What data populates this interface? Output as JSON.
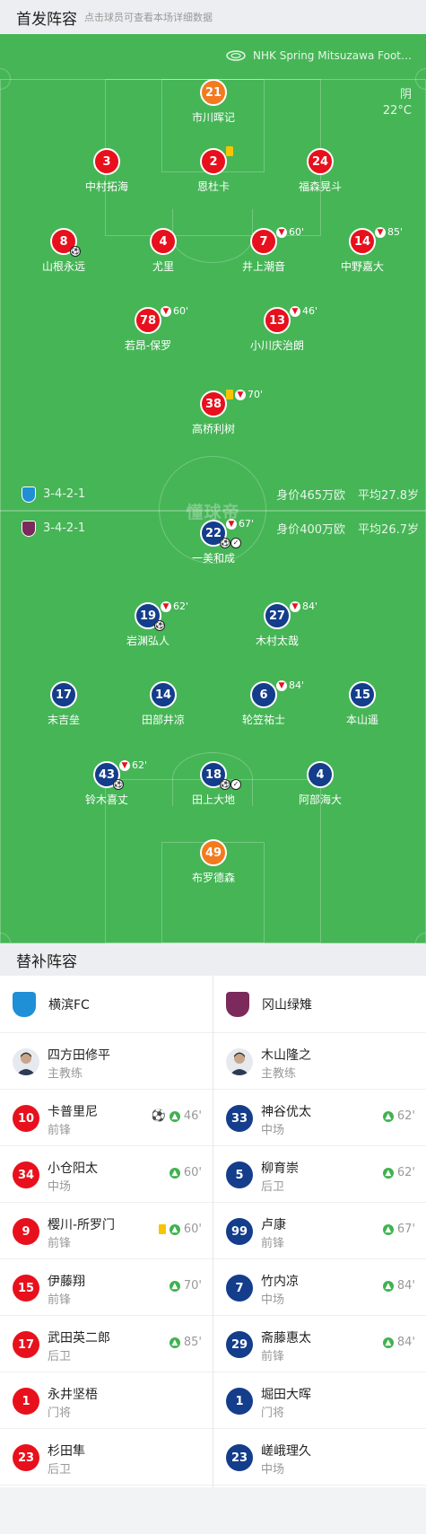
{
  "lineup_header": {
    "title": "首发阵容",
    "hint": "点击球员可查看本场详细数据"
  },
  "venue": {
    "name": "NHK Spring Mitsuzawa Foot…"
  },
  "weather": {
    "condition": "阴",
    "temp": "22°C"
  },
  "watermark": "懂球帝",
  "home_summary": {
    "formation": "3-4-2-1",
    "value": "身价465万欧",
    "age": "平均27.8岁"
  },
  "away_summary": {
    "formation": "3-4-2-1",
    "value": "身价400万欧",
    "age": "平均26.7岁"
  },
  "home_players": [
    {
      "num": "21",
      "name": "市川晖记",
      "color": "orange"
    },
    {
      "num": "3",
      "name": "中村拓海"
    },
    {
      "num": "2",
      "name": "恩杜卡",
      "yellow": true
    },
    {
      "num": "24",
      "name": "福森晃斗"
    },
    {
      "num": "8",
      "name": "山根永远",
      "goal": true
    },
    {
      "num": "4",
      "name": "尤里"
    },
    {
      "num": "7",
      "name": "井上潮音",
      "sub_out": "60'"
    },
    {
      "num": "14",
      "name": "中野嘉大",
      "sub_out": "85'"
    },
    {
      "num": "78",
      "name": "若昂-保罗",
      "sub_out": "60'"
    },
    {
      "num": "13",
      "name": "小川庆治朗",
      "sub_out": "46'"
    },
    {
      "num": "38",
      "name": "高桥利树",
      "yellow": true,
      "sub_out": "70'"
    }
  ],
  "away_players": [
    {
      "num": "22",
      "name": "一美和成",
      "sub_out": "67'",
      "goal": true,
      "assist": true
    },
    {
      "num": "19",
      "name": "岩渊弘人",
      "sub_out": "62'",
      "goal": true
    },
    {
      "num": "27",
      "name": "木村太哉",
      "sub_out": "84'"
    },
    {
      "num": "17",
      "name": "末吉垒"
    },
    {
      "num": "14",
      "name": "田部井凉"
    },
    {
      "num": "6",
      "name": "轮笠祐士",
      "sub_out": "84'"
    },
    {
      "num": "15",
      "name": "本山遥"
    },
    {
      "num": "43",
      "name": "铃木喜丈",
      "sub_out": "62'",
      "goal": true
    },
    {
      "num": "18",
      "name": "田上大地",
      "goal": true,
      "assist": true
    },
    {
      "num": "4",
      "name": "阿部海大"
    },
    {
      "num": "49",
      "name": "布罗德森",
      "color": "orange"
    }
  ],
  "subs_header": {
    "title": "替补阵容"
  },
  "home_team": {
    "name": "横滨FC"
  },
  "away_team": {
    "name": "冈山绿雉"
  },
  "home_subs": [
    {
      "coach": true,
      "name": "四方田修平",
      "pos": "主教练"
    },
    {
      "num": "10",
      "name": "卡普里尼",
      "pos": "前锋",
      "goal": true,
      "sub_in": "46'"
    },
    {
      "num": "34",
      "name": "小仓阳太",
      "pos": "中场",
      "sub_in": "60'"
    },
    {
      "num": "9",
      "name": "樱川-所罗门",
      "pos": "前锋",
      "yellow": true,
      "sub_in": "60'"
    },
    {
      "num": "15",
      "name": "伊藤翔",
      "pos": "前锋",
      "sub_in": "70'"
    },
    {
      "num": "17",
      "name": "武田英二郎",
      "pos": "后卫",
      "sub_in": "85'"
    },
    {
      "num": "1",
      "name": "永井坚梧",
      "pos": "门将"
    },
    {
      "num": "23",
      "name": "杉田隼",
      "pos": "后卫"
    }
  ],
  "away_subs": [
    {
      "coach": true,
      "name": "木山隆之",
      "pos": "主教练"
    },
    {
      "num": "33",
      "name": "神谷优太",
      "pos": "中场",
      "sub_in": "62'"
    },
    {
      "num": "5",
      "name": "柳育崇",
      "pos": "后卫",
      "sub_in": "62'"
    },
    {
      "num": "99",
      "name": "卢康",
      "pos": "前锋",
      "sub_in": "67'"
    },
    {
      "num": "7",
      "name": "竹内凉",
      "pos": "中场",
      "sub_in": "84'"
    },
    {
      "num": "29",
      "name": "斋藤惠太",
      "pos": "前锋",
      "sub_in": "84'"
    },
    {
      "num": "1",
      "name": "堀田大晖",
      "pos": "门将"
    },
    {
      "num": "23",
      "name": "嵯峨理久",
      "pos": "中场"
    }
  ],
  "colors": {
    "home": "#e8101c",
    "away": "#143d8c",
    "keeper": "#f47a1f",
    "pitch": "#46b556"
  }
}
